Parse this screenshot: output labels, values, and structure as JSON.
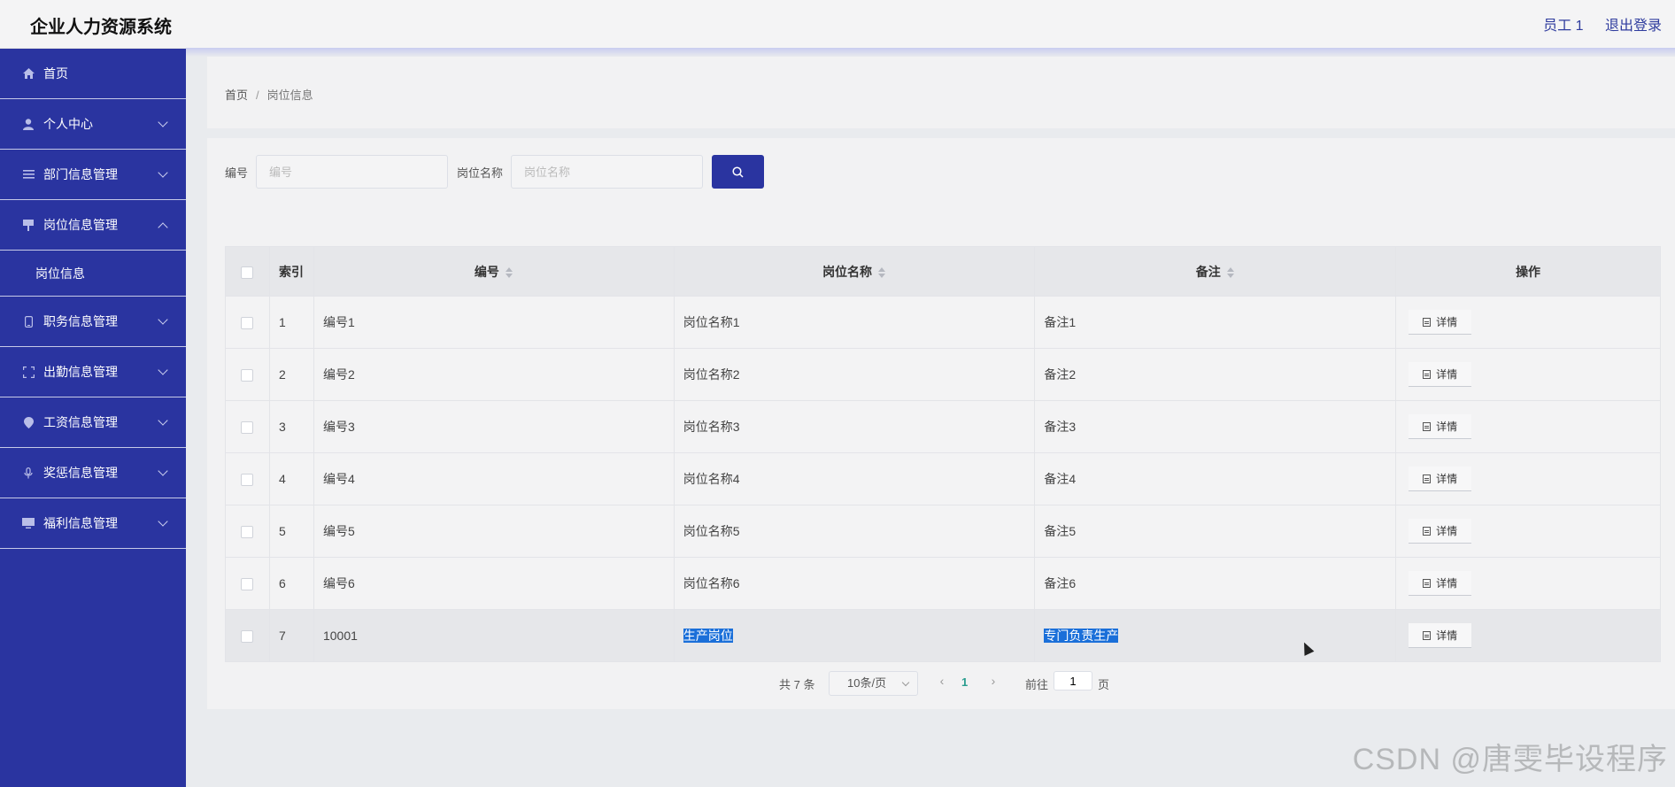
{
  "header": {
    "title": "企业人力资源系统",
    "user": "员工 1",
    "logout": "退出登录"
  },
  "sidebar": {
    "items": [
      {
        "label": "首页",
        "icon": "home-icon"
      },
      {
        "label": "个人中心",
        "icon": "user-icon"
      },
      {
        "label": "部门信息管理",
        "icon": "list-icon"
      },
      {
        "label": "岗位信息管理",
        "icon": "post-icon"
      },
      {
        "label": "职务信息管理",
        "icon": "phone-icon"
      },
      {
        "label": "出勤信息管理",
        "icon": "frame-icon"
      },
      {
        "label": "工资信息管理",
        "icon": "location-icon"
      },
      {
        "label": "奖惩信息管理",
        "icon": "microphone-icon"
      },
      {
        "label": "福利信息管理",
        "icon": "monitor-icon"
      }
    ],
    "sub_item": "岗位信息"
  },
  "breadcrumb": {
    "home": "首页",
    "separator": "/",
    "current": "岗位信息"
  },
  "search": {
    "code_label": "编号",
    "code_placeholder": "编号",
    "name_label": "岗位名称",
    "name_placeholder": "岗位名称"
  },
  "table": {
    "headers": {
      "index": "索引",
      "code": "编号",
      "name": "岗位名称",
      "note": "备注",
      "action": "操作"
    },
    "detail_label": "详情",
    "rows": [
      {
        "index": "1",
        "code": "编号1",
        "name": "岗位名称1",
        "note": "备注1"
      },
      {
        "index": "2",
        "code": "编号2",
        "name": "岗位名称2",
        "note": "备注2"
      },
      {
        "index": "3",
        "code": "编号3",
        "name": "岗位名称3",
        "note": "备注3"
      },
      {
        "index": "4",
        "code": "编号4",
        "name": "岗位名称4",
        "note": "备注4"
      },
      {
        "index": "5",
        "code": "编号5",
        "name": "岗位名称5",
        "note": "备注5"
      },
      {
        "index": "6",
        "code": "编号6",
        "name": "岗位名称6",
        "note": "备注6"
      },
      {
        "index": "7",
        "code": "10001",
        "name": "生产岗位",
        "note": "专门负责生产"
      }
    ]
  },
  "pagination": {
    "total": "共 7 条",
    "page_size": "10条/页",
    "current_page": "1",
    "goto_prefix": "前往",
    "goto_value": "1",
    "goto_suffix": "页"
  },
  "watermark": "CSDN @唐雯毕设程序",
  "colors": {
    "primary": "#2a34a0",
    "selection": "#1a6fd9"
  }
}
